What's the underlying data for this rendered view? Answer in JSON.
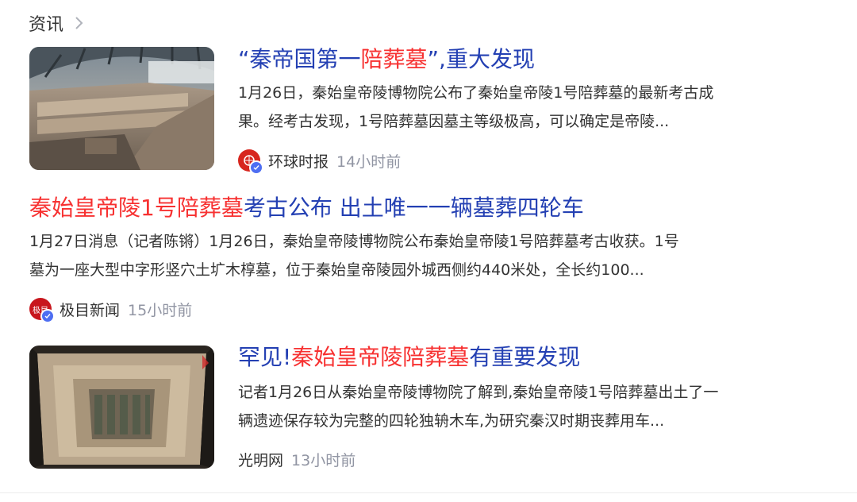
{
  "section": {
    "title": "资讯",
    "chevron_icon": "chevron-right-icon"
  },
  "items": [
    {
      "title_parts": [
        "“秦帝国第一",
        "陪葬墓",
        "”,重大发现"
      ],
      "summary_lines": [
        "1月26日，秦始皇帝陵博物院公布了秦始皇帝陵1号陪葬墓的最新考古成",
        "果。经考古发现，1号陪葬墓因墓主等级极高，可以确定是帝陵..."
      ],
      "source": "环球时报",
      "time": "14小时前",
      "logo_color": "#d7261e",
      "verified": true
    },
    {
      "title_parts": [
        "秦始皇帝陵1号陪葬墓",
        "考古公布 出土唯一一辆墓葬四轮车"
      ],
      "summary_lines": [
        "1月27日消息（记者陈锵）1月26日，秦始皇帝陵博物院公布秦始皇帝陵1号陪葬墓考古收获。1号",
        "墓为一座大型中字形竖穴土圹木椁墓，位于秦始皇帝陵园外城西侧约440米处，全长约100..."
      ],
      "source": "极目新闻",
      "time": "15小时前",
      "logo_text": "极目",
      "logo_color": "#c8161d",
      "verified": true
    },
    {
      "title_parts": [
        "罕见!",
        "秦始皇帝陵陪葬墓",
        "有重要发现"
      ],
      "summary_lines": [
        "记者1月26日从秦始皇帝陵博物院了解到,秦始皇帝陵1号陪葬墓出土了一",
        "辆遗迹保存较为完整的四轮独辀木车,为研究秦汉时期丧葬用车..."
      ],
      "source": "光明网",
      "time": "13小时前"
    }
  ],
  "colors": {
    "title_blue": "#2440b3",
    "highlight_red": "#f73131",
    "meta_gray": "#9195a3",
    "verified_blue": "#4e6ef2"
  }
}
